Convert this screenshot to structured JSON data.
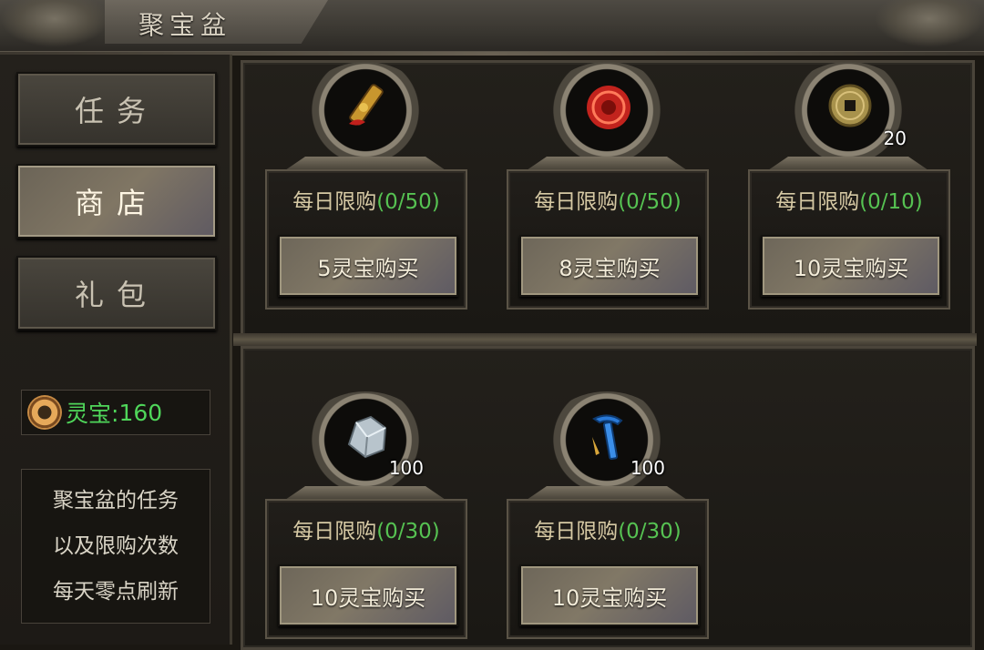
{
  "window": {
    "title": "聚宝盆"
  },
  "sidebar": {
    "tabs": [
      {
        "label": "任务",
        "active": false
      },
      {
        "label": "商店",
        "active": true
      },
      {
        "label": "礼包",
        "active": false
      }
    ],
    "currency": {
      "label": "灵宝:",
      "value": "160",
      "icon": "lingbao-coin-icon",
      "color": "#4fd65a"
    },
    "notice": [
      "聚宝盆的任务",
      "以及限购次数",
      "每天零点刷新"
    ]
  },
  "shop": {
    "items": [
      {
        "icon": "red-talisman-scroll-icon",
        "count": "",
        "limit_label": "每日限购",
        "limit_count": "(0/50)",
        "buy_label": "5灵宝购买"
      },
      {
        "icon": "red-jade-orb-icon",
        "count": "",
        "limit_label": "每日限购",
        "limit_count": "(0/50)",
        "buy_label": "8灵宝购买"
      },
      {
        "icon": "bronze-coin-icon",
        "count": "20",
        "limit_label": "每日限购",
        "limit_count": "(0/10)",
        "buy_label": "10灵宝购买"
      },
      {
        "icon": "silver-ore-icon",
        "count": "100",
        "limit_label": "每日限购",
        "limit_count": "(0/30)",
        "buy_label": "10灵宝购买"
      },
      {
        "icon": "blue-pickaxe-icon",
        "count": "100",
        "limit_label": "每日限购",
        "limit_count": "(0/30)",
        "buy_label": "10灵宝购买"
      }
    ]
  },
  "colors": {
    "accent_green": "#56c252",
    "limit_text": "#d6c9a4"
  }
}
